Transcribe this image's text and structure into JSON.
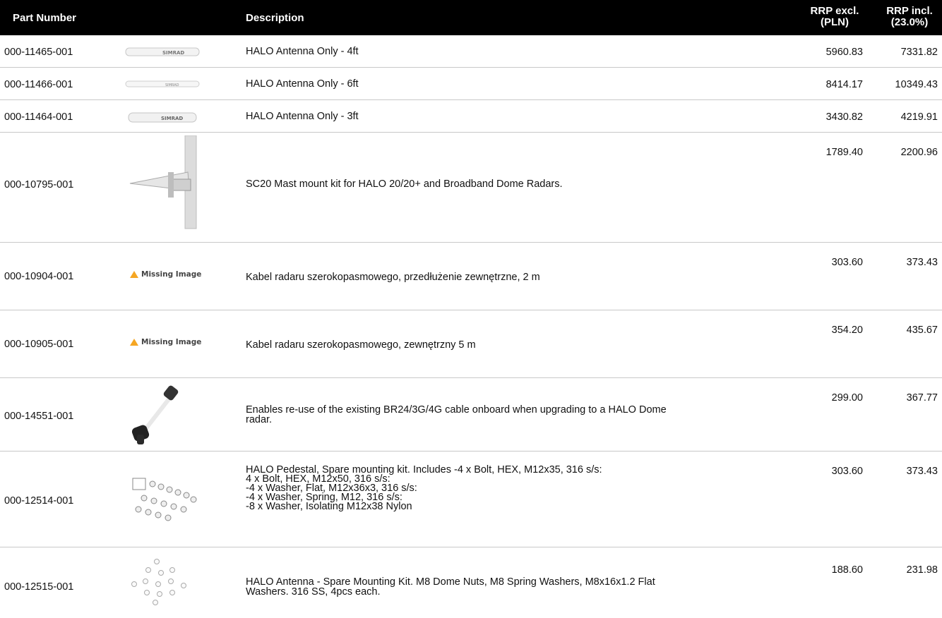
{
  "header": {
    "part_number": "Part Number",
    "description": "Description",
    "rrp_excl_line1": "RRP excl.",
    "rrp_excl_line2": "(PLN)",
    "rrp_incl_line1": "RRP incl.",
    "rrp_incl_line2": "(23.0%)"
  },
  "rows": [
    {
      "part": "000-11465-001",
      "image": "antenna-4ft",
      "desc": "HALO Antenna Only - 4ft",
      "excl": "5960.83",
      "incl": "7331.82"
    },
    {
      "part": "000-11466-001",
      "image": "antenna-6ft",
      "desc": "HALO Antenna Only - 6ft",
      "excl": "8414.17",
      "incl": "10349.43"
    },
    {
      "part": "000-11464-001",
      "image": "antenna-3ft",
      "desc": "HALO Antenna Only - 3ft",
      "excl": "3430.82",
      "incl": "4219.91"
    },
    {
      "part": "000-10795-001",
      "image": "mast-mount",
      "desc": "SC20 Mast mount kit for HALO 20/20+ and Broadband Dome Radars.",
      "excl": "1789.40",
      "incl": "2200.96"
    },
    {
      "part": "000-10904-001",
      "image": "missing",
      "desc": "Kabel radaru szerokopasmowego, przedłużenie zewnętrzne, 2 m",
      "excl": "303.60",
      "incl": "373.43"
    },
    {
      "part": "000-10905-001",
      "image": "missing",
      "desc": "Kabel radaru szerokopasmowego, zewnętrzny 5 m",
      "excl": "354.20",
      "incl": "435.67"
    },
    {
      "part": "000-14551-001",
      "image": "cable-adapter",
      "desc_lines": [
        "Enables re-use of the existing BR24/3G/4G cable onboard when upgrading to a HALO Dome",
        "radar."
      ],
      "excl": "299.00",
      "incl": "367.77"
    },
    {
      "part": "000-12514-001",
      "image": "pedestal-kit",
      "desc_lines": [
        "HALO Pedestal, Spare mounting kit. Includes -4 x Bolt, HEX, M12x35, 316 s/s:",
        "4 x Bolt, HEX, M12x50, 316 s/s:",
        "-4 x Washer, Flat, M12x36x3, 316 s/s:",
        "-4 x Washer, Spring, M12, 316 s/s:",
        "-8 x Washer, Isolating M12x38 Nylon"
      ],
      "excl": "303.60",
      "incl": "373.43"
    },
    {
      "part": "000-12515-001",
      "image": "nuts-kit",
      "desc_lines": [
        "HALO Antenna - Spare Mounting Kit. M8 Dome Nuts, M8 Spring Washers, M8x16x1.2 Flat",
        "Washers. 316 SS, 4pcs each."
      ],
      "excl": "188.60",
      "incl": "231.98"
    }
  ],
  "missing_image_label": "Missing Image",
  "antenna_brand": "SIMRAD",
  "colors": {
    "header_bg": "#000000",
    "separator": "#c8c8c8",
    "warning": "#f5a623"
  }
}
